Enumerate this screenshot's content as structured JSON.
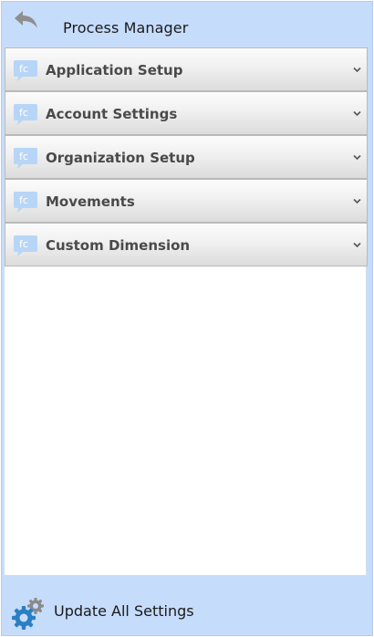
{
  "header": {
    "title": "Process Manager",
    "back_icon": "back-arrow-icon"
  },
  "menu": {
    "icon": "fc-chat-bubble-icon",
    "icon_text": "fc",
    "items": [
      {
        "label": "Application Setup"
      },
      {
        "label": "Account Settings"
      },
      {
        "label": "Organization Setup"
      },
      {
        "label": "Movements"
      },
      {
        "label": "Custom Dimension"
      }
    ]
  },
  "footer": {
    "label": "Update All Settings",
    "icon": "gears-icon"
  },
  "colors": {
    "panel": "#c6dcfb",
    "menu_text": "#4a4a4a",
    "icon_bubble": "#b7d6f7",
    "gear_blue": "#2a7fc2",
    "gear_gray": "#8a8a8a"
  }
}
